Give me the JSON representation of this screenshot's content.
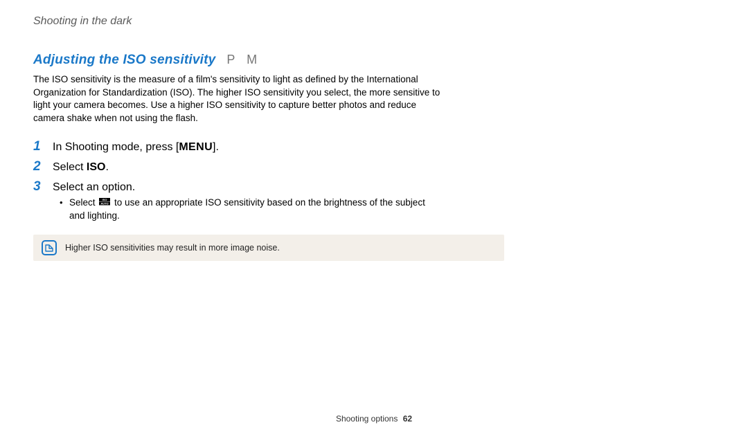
{
  "breadcrumb": "Shooting in the dark",
  "heading": "Adjusting the ISO sensitivity",
  "modes": "P M",
  "intro": "The ISO sensitivity is the measure of a film's sensitivity to light as defined by the International Organization for Standardization (ISO). The higher ISO sensitivity you select, the more sensitive to light your camera becomes. Use a higher ISO sensitivity to capture better photos and reduce camera shake when not using the flash.",
  "steps": {
    "s1": {
      "num": "1",
      "pre": "In Shooting mode, press [",
      "menu": "MENU",
      "post": "]."
    },
    "s2": {
      "num": "2",
      "pre": "Select ",
      "bold": "ISO",
      "post": "."
    },
    "s3": {
      "num": "3",
      "text": "Select an option.",
      "bullet_pre": "Select ",
      "bullet_post": " to use an appropriate ISO sensitivity based on the brightness of the subject and lighting."
    }
  },
  "note": "Higher ISO sensitivities may result in more image noise.",
  "footer": {
    "section": "Shooting options",
    "page": "62"
  }
}
